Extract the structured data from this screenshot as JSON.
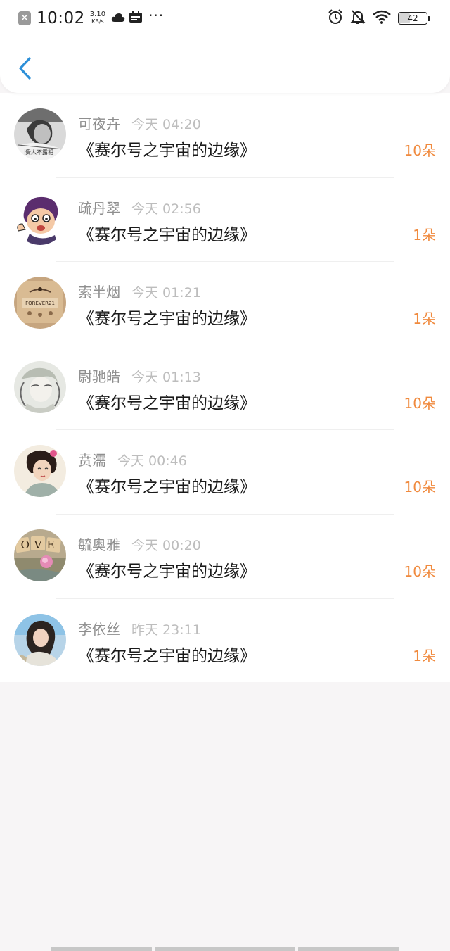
{
  "status_bar": {
    "time": "10:02",
    "speed_value": "3.10",
    "speed_unit": "KB/s",
    "more": "···",
    "battery": "42",
    "battery_level_percent": 42
  },
  "nav": {
    "back_icon": "chevron-left-icon"
  },
  "colors": {
    "accent": "#2c8fd8",
    "count": "#f08a3e",
    "name": "#8e8e8e",
    "time": "#bdbdbd"
  },
  "items": [
    {
      "name": "可夜卉",
      "time": "今天 04:20",
      "title": "《赛尔号之宇宙的边缘》",
      "count": "10朵"
    },
    {
      "name": "疏丹翠",
      "time": "今天 02:56",
      "title": "《赛尔号之宇宙的边缘》",
      "count": "1朵"
    },
    {
      "name": "索半烟",
      "time": "今天 01:21",
      "title": "《赛尔号之宇宙的边缘》",
      "count": "1朵",
      "avatar_text": "FOREVER21"
    },
    {
      "name": "尉驰皓",
      "time": "今天 01:13",
      "title": "《赛尔号之宇宙的边缘》",
      "count": "10朵"
    },
    {
      "name": "贲濡",
      "time": "今天 00:46",
      "title": "《赛尔号之宇宙的边缘》",
      "count": "10朵"
    },
    {
      "name": "毓奥雅",
      "time": "今天 00:20",
      "title": "《赛尔号之宇宙的边缘》",
      "count": "10朵",
      "avatar_text": "OVE"
    },
    {
      "name": "李依丝",
      "time": "昨天 23:11",
      "title": "《赛尔号之宇宙的边缘》",
      "count": "1朵"
    }
  ]
}
